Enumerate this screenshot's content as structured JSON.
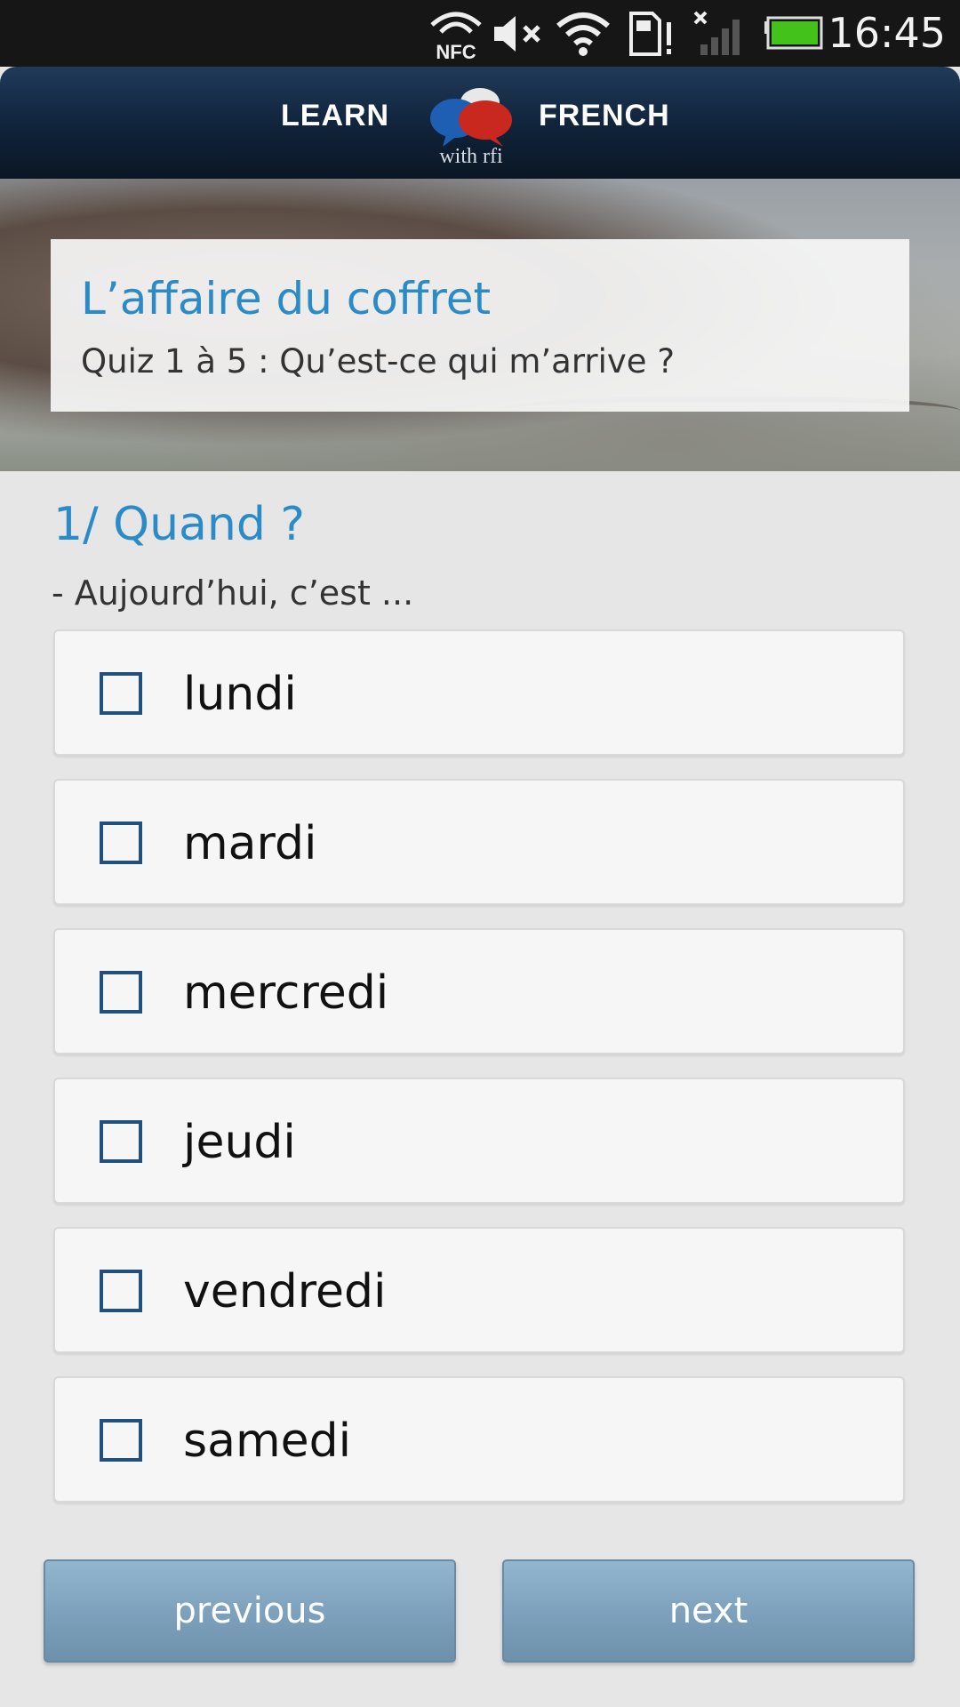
{
  "status_bar": {
    "time": "16:45",
    "nfc_label": "NFC",
    "icons": [
      "nfc-icon",
      "volume-muted-icon",
      "wifi-icon",
      "sd-card-alert-icon",
      "no-signal-icon",
      "battery-icon"
    ],
    "battery_color": "#44c21c"
  },
  "header": {
    "word_left": "LEARN",
    "word_right": "FRENCH",
    "logo_sub": "with rfi",
    "colors": {
      "bubble_blue": "#1f5fb3",
      "bubble_red": "#c8281e",
      "bubble_white": "#e8e8e8"
    }
  },
  "banner": {
    "title": "L’affaire du coffret",
    "subtitle": "Quiz  1 à 5 : Qu’est-ce qui m’arrive ?"
  },
  "question": {
    "title": "1/ Quand ?",
    "prompt": "- Aujourd’hui, c’est ...",
    "options": [
      {
        "label": "lundi",
        "checked": false
      },
      {
        "label": "mardi",
        "checked": false
      },
      {
        "label": "mercredi",
        "checked": false
      },
      {
        "label": "jeudi",
        "checked": false
      },
      {
        "label": "vendredi",
        "checked": false
      },
      {
        "label": "samedi",
        "checked": false
      }
    ]
  },
  "nav": {
    "previous_label": "previous",
    "next_label": "next"
  },
  "colors": {
    "accent": "#2b8bc6",
    "checkbox_border": "#20507e",
    "button": "#7ea2bd"
  }
}
